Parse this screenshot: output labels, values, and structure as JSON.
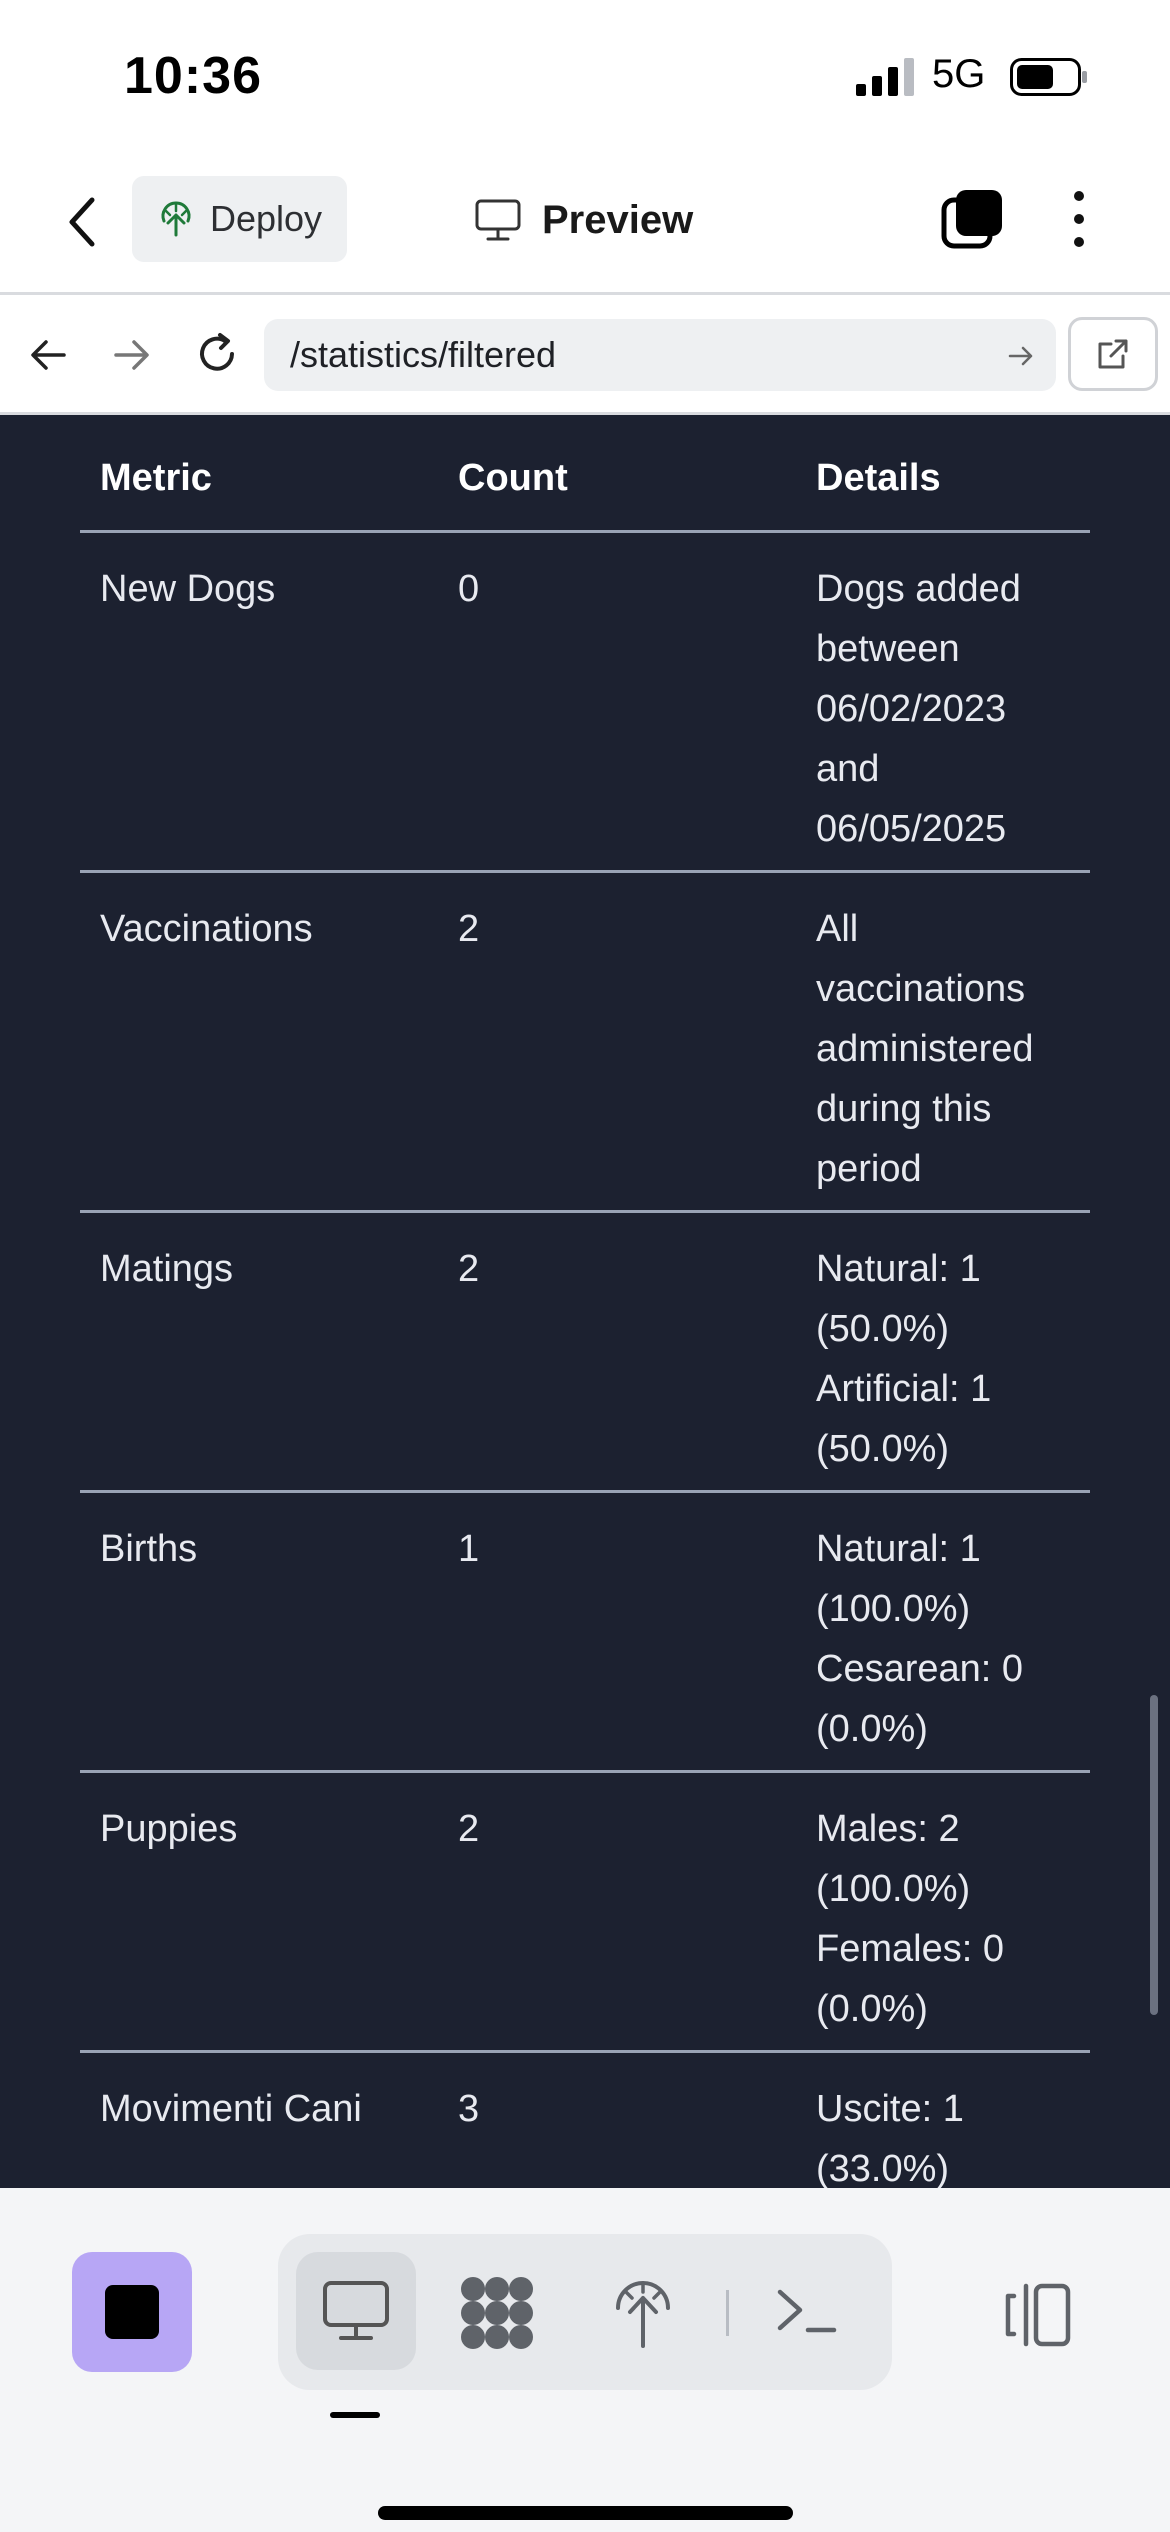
{
  "status_bar": {
    "time": "10:36",
    "network": "5G"
  },
  "app_bar": {
    "deploy_label": "Deploy",
    "title": "Preview"
  },
  "url_bar": {
    "url": "/statistics/filtered"
  },
  "table": {
    "headers": [
      "Metric",
      "Count",
      "Details"
    ],
    "rows": [
      {
        "metric": "New Dogs",
        "count": "0",
        "details": [
          "Dogs added",
          "between",
          "06/02/2023",
          "and",
          "06/05/2025"
        ]
      },
      {
        "metric": "Vaccinations",
        "count": "2",
        "details": [
          "All",
          "vaccinations",
          "administered",
          "during this",
          "period"
        ]
      },
      {
        "metric": "Matings",
        "count": "2",
        "details": [
          "Natural: 1",
          "(50.0%)",
          "Artificial: 1",
          "(50.0%)"
        ]
      },
      {
        "metric": "Births",
        "count": "1",
        "details": [
          "Natural: 1",
          "(100.0%)",
          "Cesarean: 0",
          "(0.0%)"
        ]
      },
      {
        "metric": "Puppies",
        "count": "2",
        "details": [
          "Males: 2",
          "(100.0%)",
          "Females: 0",
          "(0.0%)"
        ]
      },
      {
        "metric": "Movimenti Cani",
        "count": "3",
        "details": [
          "Uscite: 1",
          "(33.0%)"
        ]
      }
    ]
  },
  "colors": {
    "content_bg": "#1c2130",
    "stop_button": "#b7a6f5",
    "divider": "#9aa3b5"
  }
}
